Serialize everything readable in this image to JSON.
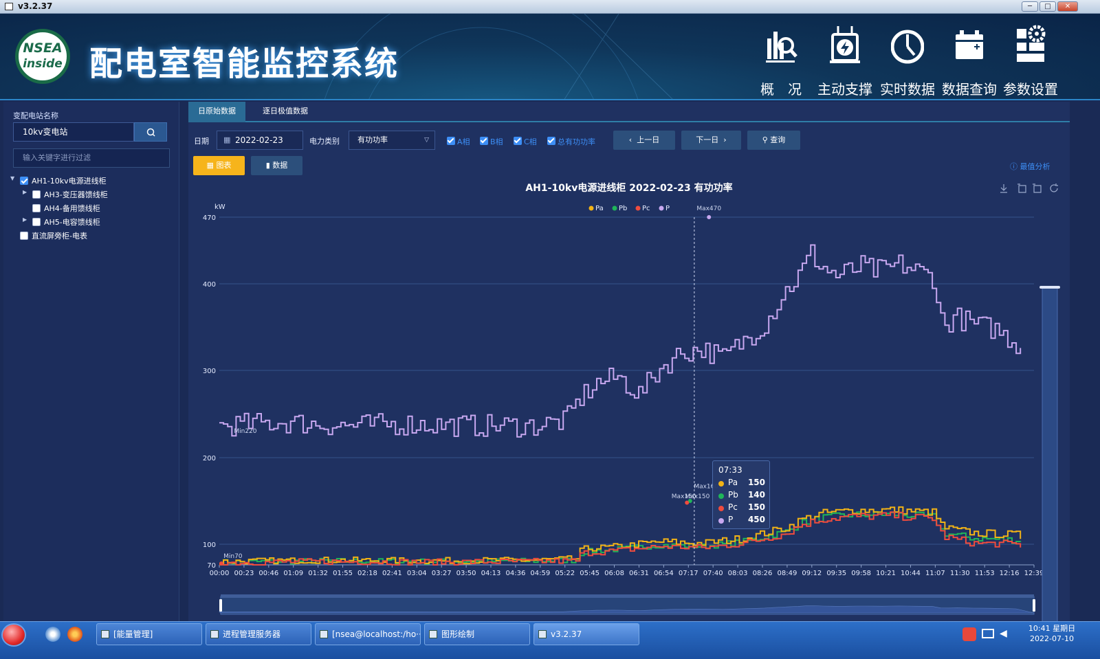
{
  "window": {
    "title": "v3.2.37",
    "minimize": "─",
    "maximize": "□",
    "close": "✕"
  },
  "header": {
    "logo_top": "NSEA",
    "logo_bottom": "inside",
    "title": "配电室智能监控系统",
    "nav": [
      {
        "label": "概　况",
        "icon": "overview-chart-icon"
      },
      {
        "label": "主动支撑",
        "icon": "power-support-icon"
      },
      {
        "label": "实时数据",
        "icon": "realtime-clock-icon"
      },
      {
        "label": "数据查询",
        "icon": "data-query-icon"
      },
      {
        "label": "参数设置",
        "icon": "settings-icon"
      }
    ]
  },
  "sidebar": {
    "station_label": "变配电站名称",
    "station_value": "10kv变电站",
    "filter_placeholder": "输入关键字进行过滤",
    "tree": [
      {
        "label": "AH1-10kv电源进线柜",
        "checked": true,
        "expanded": true,
        "level": 0
      },
      {
        "label": "AH3-变压器馈线柜",
        "checked": false,
        "expanded": false,
        "level": 1
      },
      {
        "label": "AH4-备用馈线柜",
        "checked": false,
        "level": 1
      },
      {
        "label": "AH5-电容馈线柜",
        "checked": false,
        "expanded": false,
        "level": 1
      },
      {
        "label": "直流屏旁柜-电表",
        "checked": false,
        "level": 0
      }
    ]
  },
  "tabs": [
    "日原始数据",
    "逐日极值数据"
  ],
  "toolbar": {
    "date_label": "日期",
    "date_value": "2022-02-23",
    "type_label": "电力类别",
    "type_value": "有功功率",
    "checks": [
      "A相",
      "B相",
      "C相",
      "总有功功率"
    ],
    "prev_label": "上一日",
    "next_label": "下一日",
    "query_label": "查询",
    "chart_btn": "图表",
    "data_btn": "数据",
    "extreme_link": "最值分析"
  },
  "chart_data": {
    "type": "line",
    "title": "AH1-10kv电源进线柜  2022-02-23  有功功率",
    "ylabel": "kW",
    "ylim": [
      70,
      470
    ],
    "yticks": [
      70,
      100,
      200,
      300,
      400,
      470
    ],
    "x_ticks": [
      "00:00",
      "00:23",
      "00:46",
      "01:09",
      "01:32",
      "01:55",
      "02:18",
      "02:41",
      "03:04",
      "03:27",
      "03:50",
      "04:13",
      "04:36",
      "04:59",
      "05:22",
      "05:45",
      "06:08",
      "06:31",
      "06:54",
      "07:17",
      "07:40",
      "08:03",
      "08:26",
      "08:49",
      "09:12",
      "09:35",
      "09:58",
      "10:21",
      "10:44",
      "11:07",
      "11:30",
      "11:53",
      "12:16",
      "12:39"
    ],
    "x_range_minutes": [
      0,
      777
    ],
    "legend": [
      {
        "name": "Pa",
        "color": "#f2b316"
      },
      {
        "name": "Pb",
        "color": "#1fb559"
      },
      {
        "name": "Pc",
        "color": "#ef4c3e"
      },
      {
        "name": "P",
        "color": "#c8a8f0"
      }
    ],
    "series": [
      {
        "name": "P",
        "color": "#c8a8f0",
        "keypoints": [
          [
            0,
            234
          ],
          [
            60,
            238
          ],
          [
            120,
            234
          ],
          [
            180,
            236
          ],
          [
            240,
            234
          ],
          [
            300,
            234
          ],
          [
            330,
            240
          ],
          [
            345,
            268
          ],
          [
            360,
            283
          ],
          [
            380,
            290
          ],
          [
            400,
            270
          ],
          [
            420,
            300
          ],
          [
            440,
            318
          ],
          [
            460,
            322
          ],
          [
            480,
            312
          ],
          [
            500,
            332
          ],
          [
            520,
            352
          ],
          [
            540,
            390
          ],
          [
            555,
            410
          ],
          [
            563,
            430
          ],
          [
            575,
            415
          ],
          [
            590,
            405
          ],
          [
            610,
            415
          ],
          [
            630,
            410
          ],
          [
            650,
            418
          ],
          [
            670,
            408
          ],
          [
            680,
            405
          ],
          [
            690,
            345
          ],
          [
            700,
            360
          ],
          [
            720,
            350
          ],
          [
            740,
            345
          ],
          [
            760,
            328
          ],
          [
            780,
            330
          ],
          [
            800,
            318
          ],
          [
            815,
            292
          ],
          [
            830,
            305
          ],
          [
            850,
            298
          ],
          [
            870,
            285
          ],
          [
            890,
            272
          ],
          [
            910,
            270
          ],
          [
            940,
            272
          ],
          [
            967,
            290
          ]
        ]
      },
      {
        "name": "Pa",
        "color": "#f2b316",
        "keypoints": [
          [
            0,
            74
          ],
          [
            100,
            76
          ],
          [
            200,
            75
          ],
          [
            300,
            76
          ],
          [
            340,
            78
          ],
          [
            345,
            92
          ],
          [
            380,
            96
          ],
          [
            420,
            102
          ],
          [
            460,
            100
          ],
          [
            500,
            106
          ],
          [
            540,
            118
          ],
          [
            555,
            128
          ],
          [
            575,
            135
          ],
          [
            600,
            138
          ],
          [
            640,
            139
          ],
          [
            680,
            136
          ],
          [
            690,
            118
          ],
          [
            720,
            112
          ],
          [
            760,
            110
          ],
          [
            780,
            96
          ],
          [
            820,
            88
          ],
          [
            860,
            86
          ],
          [
            900,
            83
          ],
          [
            940,
            84
          ],
          [
            967,
            92
          ]
        ]
      },
      {
        "name": "Pb",
        "color": "#1fb559",
        "keypoints": [
          [
            0,
            73
          ],
          [
            100,
            75
          ],
          [
            200,
            74
          ],
          [
            300,
            75
          ],
          [
            340,
            76
          ],
          [
            345,
            88
          ],
          [
            380,
            92
          ],
          [
            420,
            98
          ],
          [
            460,
            96
          ],
          [
            500,
            102
          ],
          [
            540,
            114
          ],
          [
            555,
            124
          ],
          [
            575,
            130
          ],
          [
            600,
            133
          ],
          [
            640,
            134
          ],
          [
            680,
            131
          ],
          [
            690,
            112
          ],
          [
            720,
            106
          ],
          [
            760,
            104
          ],
          [
            780,
            92
          ],
          [
            820,
            85
          ],
          [
            860,
            83
          ],
          [
            900,
            81
          ],
          [
            940,
            82
          ],
          [
            967,
            86
          ]
        ]
      },
      {
        "name": "Pc",
        "color": "#ef4c3e",
        "keypoints": [
          [
            0,
            72
          ],
          [
            100,
            74
          ],
          [
            200,
            73
          ],
          [
            300,
            74
          ],
          [
            340,
            75
          ],
          [
            345,
            86
          ],
          [
            380,
            90
          ],
          [
            420,
            96
          ],
          [
            460,
            94
          ],
          [
            500,
            100
          ],
          [
            540,
            112
          ],
          [
            555,
            122
          ],
          [
            575,
            128
          ],
          [
            600,
            131
          ],
          [
            640,
            132
          ],
          [
            680,
            129
          ],
          [
            690,
            108
          ],
          [
            720,
            100
          ],
          [
            760,
            99
          ],
          [
            780,
            88
          ],
          [
            820,
            82
          ],
          [
            860,
            80
          ],
          [
            900,
            79
          ],
          [
            940,
            80
          ],
          [
            967,
            88
          ]
        ]
      }
    ],
    "markers": [
      {
        "label": "Max470",
        "series": "P"
      },
      {
        "label": "Min220",
        "series": "P"
      },
      {
        "label": "Max160",
        "series": "Pa"
      },
      {
        "label": "Max150",
        "series": "Pb"
      },
      {
        "label": "Max150",
        "series": "Pc"
      },
      {
        "label": "Min70",
        "series": "Pc"
      }
    ],
    "tooltip": {
      "time": "07:33",
      "rows": [
        [
          "Pa",
          "150",
          "#f2b316"
        ],
        [
          "Pb",
          "140",
          "#1fb559"
        ],
        [
          "Pc",
          "150",
          "#ef4c3e"
        ],
        [
          "P",
          "450",
          "#c8a8f0"
        ]
      ]
    },
    "cursor_time_minutes": 453
  },
  "taskbar": {
    "items": [
      {
        "label": "[能量管理]"
      },
      {
        "label": "进程管理服务器"
      },
      {
        "label": "[nsea@localhost:/ho···"
      },
      {
        "label": "图形绘制"
      },
      {
        "label": "v3.2.37",
        "active": true
      }
    ],
    "time": "10:41 星期日",
    "date": "2022-07-10"
  }
}
